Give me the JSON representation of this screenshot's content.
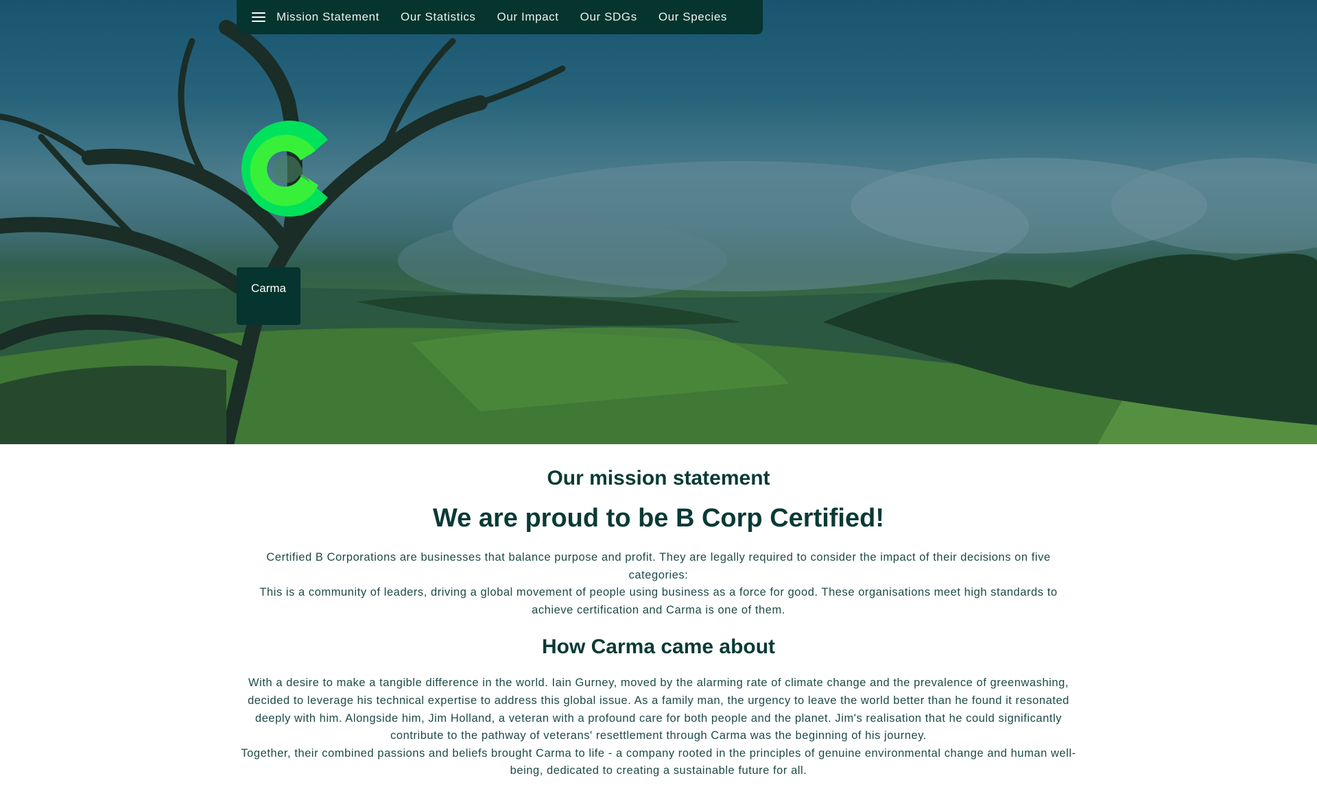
{
  "nav": {
    "items": [
      {
        "label": "Mission Statement"
      },
      {
        "label": "Our Statistics"
      },
      {
        "label": "Our Impact"
      },
      {
        "label": "Our SDGs"
      },
      {
        "label": "Our Species"
      }
    ]
  },
  "hero": {
    "brand_name": "Carma"
  },
  "colors": {
    "nav_bg": "#06342f",
    "heading": "#0a3a36",
    "logo_outer": "#00e25b",
    "logo_inner": "#38f03a"
  },
  "mission": {
    "heading": "Our mission statement",
    "title": "We are proud to be B Corp Certified!",
    "paragraph_1": "Certified B Corporations are businesses that balance purpose and profit. They are legally required to consider the impact of their decisions on five categories:",
    "paragraph_2": "This is a community of leaders, driving a global movement of people using business as a force for good. These organisations meet high standards to achieve certification and Carma is one of them."
  },
  "about": {
    "heading": "How Carma came about",
    "paragraph_1": "With a desire to make a tangible difference in the world. Iain Gurney, moved by the alarming rate of climate change and the prevalence of greenwashing, decided to leverage his technical expertise to address this global issue. As a family man, the urgency to leave the world better than he found it resonated deeply with him.  Alongside him, Jim Holland, a veteran with a profound care for both people and the planet. Jim's realisation that he could significantly contribute to the pathway of veterans' resettlement through Carma was the beginning of his journey.",
    "paragraph_2": "Together, their combined passions and beliefs brought Carma to life - a company rooted in the principles of genuine environmental change and human well-being, dedicated to creating a sustainable future for all."
  }
}
